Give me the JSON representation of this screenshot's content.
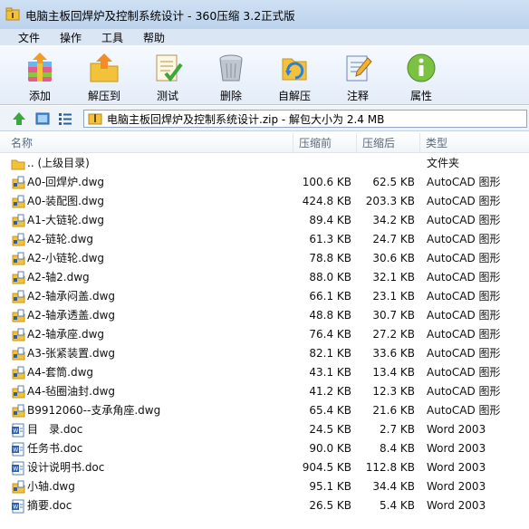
{
  "window": {
    "title": "电脑主板回焊炉及控制系统设计 - 360压缩 3.2正式版"
  },
  "menu": [
    "文件",
    "操作",
    "工具",
    "帮助"
  ],
  "toolbar": {
    "add": "添加",
    "extract": "解压到",
    "test": "测试",
    "delete": "删除",
    "sfx": "自解压",
    "comment": "注释",
    "properties": "属性"
  },
  "address": {
    "text": "电脑主板回焊炉及控制系统设计.zip - 解包大小为 2.4 MB"
  },
  "columns": {
    "name": "名称",
    "compressed": "压缩前",
    "packed": "压缩后",
    "type": "类型"
  },
  "files": [
    {
      "name": ".. (上级目录)",
      "compressed": "",
      "packed": "",
      "type": "文件夹",
      "icon": "folder"
    },
    {
      "name": "A0-回焊炉.dwg",
      "compressed": "100.6 KB",
      "packed": "62.5 KB",
      "type": "AutoCAD 图形",
      "icon": "dwg"
    },
    {
      "name": "A0-装配图.dwg",
      "compressed": "424.8 KB",
      "packed": "203.3 KB",
      "type": "AutoCAD 图形",
      "icon": "dwg"
    },
    {
      "name": "A1-大链轮.dwg",
      "compressed": "89.4 KB",
      "packed": "34.2 KB",
      "type": "AutoCAD 图形",
      "icon": "dwg"
    },
    {
      "name": "A2-链轮.dwg",
      "compressed": "61.3 KB",
      "packed": "24.7 KB",
      "type": "AutoCAD 图形",
      "icon": "dwg"
    },
    {
      "name": "A2-小链轮.dwg",
      "compressed": "78.8 KB",
      "packed": "30.6 KB",
      "type": "AutoCAD 图形",
      "icon": "dwg"
    },
    {
      "name": "A2-轴2.dwg",
      "compressed": "88.0 KB",
      "packed": "32.1 KB",
      "type": "AutoCAD 图形",
      "icon": "dwg"
    },
    {
      "name": "A2-轴承闷盖.dwg",
      "compressed": "66.1 KB",
      "packed": "23.1 KB",
      "type": "AutoCAD 图形",
      "icon": "dwg"
    },
    {
      "name": "A2-轴承透盖.dwg",
      "compressed": "48.8 KB",
      "packed": "30.7 KB",
      "type": "AutoCAD 图形",
      "icon": "dwg"
    },
    {
      "name": "A2-轴承座.dwg",
      "compressed": "76.4 KB",
      "packed": "27.2 KB",
      "type": "AutoCAD 图形",
      "icon": "dwg"
    },
    {
      "name": "A3-张紧装置.dwg",
      "compressed": "82.1 KB",
      "packed": "33.6 KB",
      "type": "AutoCAD 图形",
      "icon": "dwg"
    },
    {
      "name": "A4-套筒.dwg",
      "compressed": "43.1 KB",
      "packed": "13.4 KB",
      "type": "AutoCAD 图形",
      "icon": "dwg"
    },
    {
      "name": "A4-毡圈油封.dwg",
      "compressed": "41.2 KB",
      "packed": "12.3 KB",
      "type": "AutoCAD 图形",
      "icon": "dwg"
    },
    {
      "name": "B9912060--支承角座.dwg",
      "compressed": "65.4 KB",
      "packed": "21.6 KB",
      "type": "AutoCAD 图形",
      "icon": "dwg"
    },
    {
      "name": "目　录.doc",
      "compressed": "24.5 KB",
      "packed": "2.7 KB",
      "type": "Word 2003",
      "icon": "doc"
    },
    {
      "name": "任务书.doc",
      "compressed": "90.0 KB",
      "packed": "8.4 KB",
      "type": "Word 2003",
      "icon": "doc"
    },
    {
      "name": "设计说明书.doc",
      "compressed": "904.5 KB",
      "packed": "112.8 KB",
      "type": "Word 2003",
      "icon": "doc"
    },
    {
      "name": "小轴.dwg",
      "compressed": "95.1 KB",
      "packed": "34.4 KB",
      "type": "Word 2003",
      "icon": "dwg"
    },
    {
      "name": "摘要.doc",
      "compressed": "26.5 KB",
      "packed": "5.4 KB",
      "type": "Word 2003",
      "icon": "doc"
    }
  ]
}
